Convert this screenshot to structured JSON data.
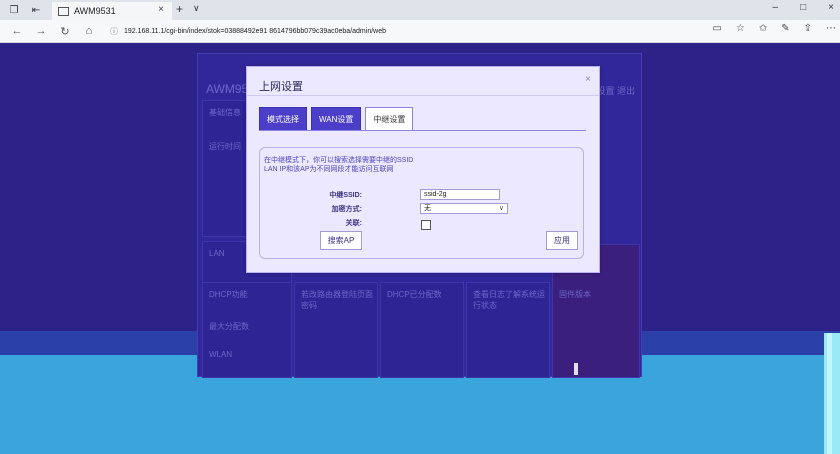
{
  "browser": {
    "tab_title": "AWM9531",
    "tab_close": "×",
    "new_tab": "+",
    "tab_menu": "∨",
    "url": "192.168.11.1/cgi-bin/index/stok=03888492e91 8614796bb079c39ac0eba/admin/web",
    "window_controls": [
      "–",
      "□",
      "×"
    ]
  },
  "admin": {
    "title": "AWM9531",
    "actions": "设置  退出",
    "cards": [
      {
        "text": "DHCP功能"
      },
      {
        "text": "若改路由器登陆页面密码"
      },
      {
        "text": "DHCP已分配数"
      },
      {
        "text": "查看日志了解系统运行状态"
      },
      {
        "text": "固件版本"
      }
    ],
    "left_labels": [
      "基础信息",
      "运行时间",
      "LAN",
      "最大分配数",
      "WLAN"
    ]
  },
  "modal": {
    "title": "上网设置",
    "close": "×",
    "tabs": [
      {
        "label": "模式选择",
        "active": false
      },
      {
        "label": "WAN设置",
        "active": false
      },
      {
        "label": "中继设置",
        "active": true
      }
    ],
    "description_line1": "在中继模式下，你可以搜索选择需要中继的SSID",
    "description_line2": "LAN IP和该AP为不同网段才能访问互联网",
    "fields": {
      "ssid_label": "中继SSID:",
      "ssid_value": "ssid-2g",
      "encryption_label": "加密方式:",
      "encryption_value": "无",
      "bridge_label": "关联:"
    },
    "search_button": "搜索AP",
    "apply_button": "应用"
  }
}
